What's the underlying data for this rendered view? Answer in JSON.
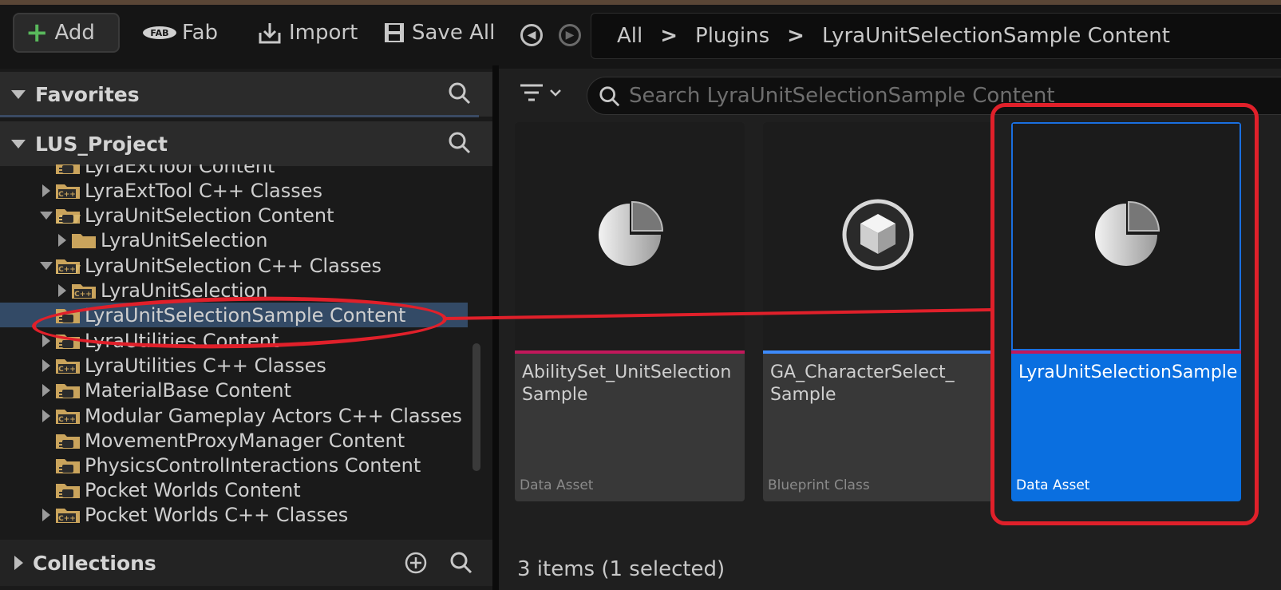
{
  "toolbar": {
    "add_label": "Add",
    "fab_label": "Fab",
    "fab_logo_text": "FAB",
    "import_label": "Import",
    "save_all_label": "Save All"
  },
  "breadcrumb": {
    "items": [
      "All",
      "Plugins",
      "LyraUnitSelectionSample Content"
    ]
  },
  "sidebar": {
    "favorites_label": "Favorites",
    "project_label": "LUS_Project",
    "collections_label": "Collections",
    "tree": [
      {
        "label": "LyraExtTool Content",
        "caret": "none",
        "icon": "plugin-folder"
      },
      {
        "label": "LyraExtTool C++ Classes",
        "caret": "right",
        "icon": "cpp-folder"
      },
      {
        "label": "LyraUnitSelection Content",
        "caret": "down",
        "icon": "plugin-folder-open"
      },
      {
        "label": "LyraUnitSelection",
        "caret": "right",
        "icon": "folder"
      },
      {
        "label": "LyraUnitSelection C++ Classes",
        "caret": "down",
        "icon": "cpp-folder-open"
      },
      {
        "label": "LyraUnitSelection",
        "caret": "right",
        "icon": "cpp-folder"
      },
      {
        "label": "LyraUnitSelectionSample Content",
        "caret": "none",
        "icon": "plugin-folder",
        "selected": true
      },
      {
        "label": "LyraUtilities Content",
        "caret": "right",
        "icon": "plugin-folder"
      },
      {
        "label": "LyraUtilities C++ Classes",
        "caret": "right",
        "icon": "cpp-folder"
      },
      {
        "label": "MaterialBase Content",
        "caret": "right",
        "icon": "plugin-folder"
      },
      {
        "label": "Modular Gameplay Actors C++ Classes",
        "caret": "right",
        "icon": "cpp-folder"
      },
      {
        "label": "MovementProxyManager Content",
        "caret": "none",
        "icon": "plugin-folder"
      },
      {
        "label": "PhysicsControlInteractions Content",
        "caret": "none",
        "icon": "plugin-folder"
      },
      {
        "label": "Pocket Worlds Content",
        "caret": "none",
        "icon": "plugin-folder"
      },
      {
        "label": "Pocket Worlds C++ Classes",
        "caret": "right",
        "icon": "cpp-folder"
      }
    ]
  },
  "content": {
    "search_placeholder": "Search LyraUnitSelectionSample Content",
    "assets": [
      {
        "name": "AbilitySet_UnitSelection Sample",
        "type": "Data Asset",
        "icon": "pie-icon",
        "band_color": "#c2185b",
        "selected": false
      },
      {
        "name": "GA_CharacterSelect_ Sample",
        "type": "Blueprint Class",
        "icon": "cube-icon",
        "band_color": "#3d8bfd",
        "selected": false
      },
      {
        "name": "LyraUnitSelectionSample",
        "type": "Data Asset",
        "icon": "pie-icon",
        "band_color": "#c2185b",
        "selected": true
      }
    ],
    "status": "3 items (1 selected)"
  },
  "colors": {
    "accent": "#0a6fe0",
    "selection_row": "#334a66",
    "annotation": "#e0202a",
    "add_green": "#59b85c"
  }
}
